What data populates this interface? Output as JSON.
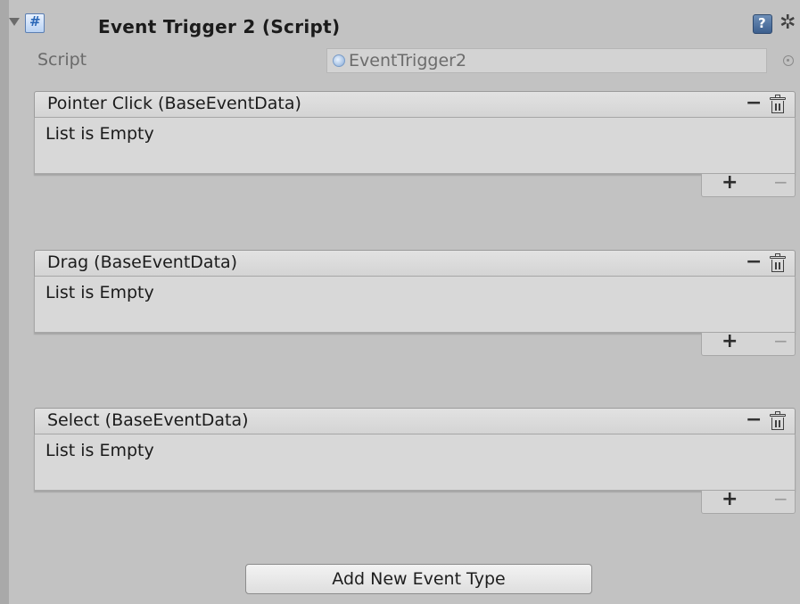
{
  "component": {
    "title": "Event Trigger 2 (Script)",
    "script_label": "Script",
    "script_value": "EventTrigger2",
    "icons": {
      "foldout": "triangle-down-icon",
      "script": "csharp-script-icon",
      "help": "help-book-icon",
      "settings": "gear-icon",
      "object_picker": "object-picker-icon"
    }
  },
  "events": [
    {
      "title": "Pointer Click (BaseEventData)",
      "empty_text": "List is Empty",
      "remove_label": "−",
      "add_label": "+",
      "remove_item_label": "−"
    },
    {
      "title": "Drag (BaseEventData)",
      "empty_text": "List is Empty",
      "remove_label": "−",
      "add_label": "+",
      "remove_item_label": "−"
    },
    {
      "title": "Select (BaseEventData)",
      "empty_text": "List is Empty",
      "remove_label": "−",
      "add_label": "+",
      "remove_item_label": "−"
    }
  ],
  "add_event_button": "Add New Event Type",
  "colors": {
    "panel_bg": "#c2c2c2",
    "header_bg": "#dcdcdc",
    "body_bg": "#d8d8d8",
    "disabled_text": "#9a9a9a"
  }
}
